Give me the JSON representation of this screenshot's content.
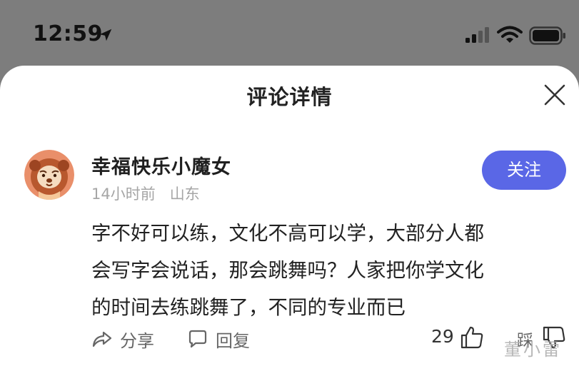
{
  "status_bar": {
    "time": "12:59"
  },
  "sheet": {
    "title": "评论详情"
  },
  "comment": {
    "username": "幸福快乐小魔女",
    "time_ago": "14小时前",
    "location": "山东",
    "follow_label": "关注",
    "text_lines": [
      "字不好可以练，文化不高可以学，大部分人都",
      "会写字会说话，那会跳舞吗？人家把你学文化",
      "的时间去练跳舞了，不同的专业而已"
    ]
  },
  "actions": {
    "share_label": "分享",
    "reply_label": "回复",
    "like_count": "29",
    "dislike_label": "踩"
  },
  "watermark": "董小雷",
  "colors": {
    "backdrop": "#7d7d7d",
    "follow_button": "#5a67e6",
    "meta_text": "#a6a6a6"
  },
  "icons": [
    "location-arrow-icon",
    "signal-icon",
    "wifi-icon",
    "battery-icon",
    "close-icon",
    "share-icon",
    "comment-icon",
    "thumbs-up-icon",
    "thumbs-down-icon"
  ]
}
